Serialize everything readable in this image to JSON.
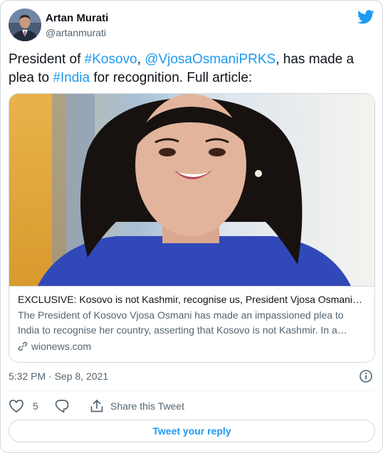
{
  "author": {
    "display_name": "Artan Murati",
    "handle": "@artanmurati",
    "avatar_icon": "profile-photo",
    "brand_icon": "twitter-bird-icon"
  },
  "tweet": {
    "text_parts": [
      {
        "text": "President of ",
        "link": false
      },
      {
        "text": "#Kosovo",
        "link": true
      },
      {
        "text": ", ",
        "link": false
      },
      {
        "text": "@VjosaOsmaniPRKS",
        "link": true
      },
      {
        "text": ", has made a plea to ",
        "link": false
      },
      {
        "text": "#India",
        "link": true
      },
      {
        "text": " for recognition. Full article:",
        "link": false
      }
    ]
  },
  "card": {
    "title": "EXCLUSIVE: Kosovo is not Kashmir, recognise us, President Vjosa Osmani…",
    "description": "The President of Kosovo Vjosa Osmani has made an impassioned plea to India to recognise her country, asserting that Kosovo is not Kashmir. In a…",
    "domain": "wionews.com"
  },
  "meta": {
    "time": "5:32 PM",
    "separator": " · ",
    "date": "Sep 8, 2021"
  },
  "actions": {
    "like_count": "5",
    "share_label": "Share this Tweet"
  },
  "reply_button": "Tweet your reply",
  "colors": {
    "accent": "#1d9bf0",
    "text": "#0f1419",
    "secondary": "#536471",
    "border": "#cfd9de"
  }
}
